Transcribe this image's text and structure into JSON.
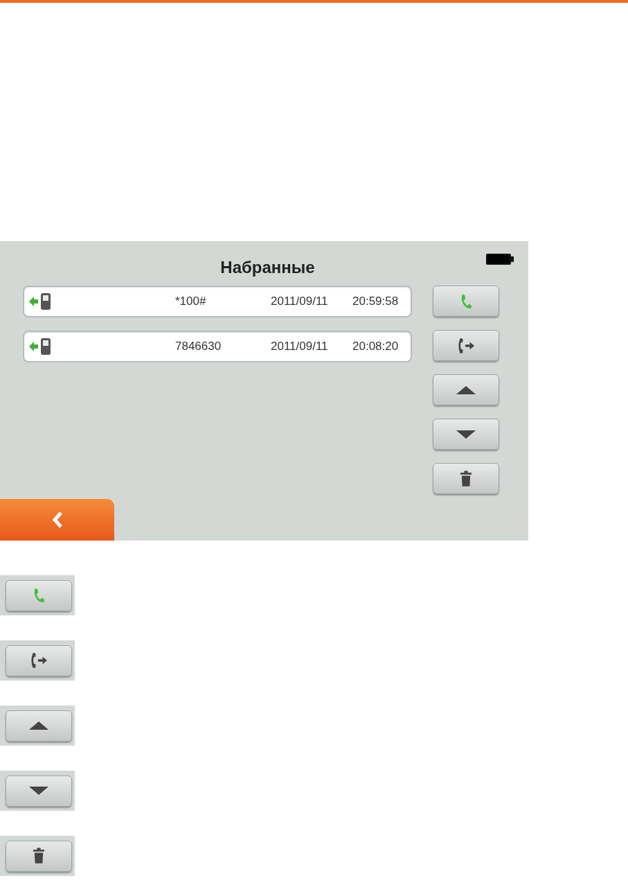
{
  "screen": {
    "title": "Набранные",
    "calls": [
      {
        "number": "*100#",
        "date": "2011/09/11",
        "time": "20:59:58"
      },
      {
        "number": "7846630",
        "date": "2011/09/11",
        "time": "20:08:20"
      }
    ],
    "side_buttons": [
      {
        "kind": "call"
      },
      {
        "kind": "transfer"
      },
      {
        "kind": "up"
      },
      {
        "kind": "down"
      },
      {
        "kind": "delete"
      }
    ],
    "back_button": {
      "kind": "back"
    }
  },
  "legend": [
    {
      "kind": "call"
    },
    {
      "kind": "transfer"
    },
    {
      "kind": "up"
    },
    {
      "kind": "down"
    },
    {
      "kind": "delete"
    }
  ]
}
